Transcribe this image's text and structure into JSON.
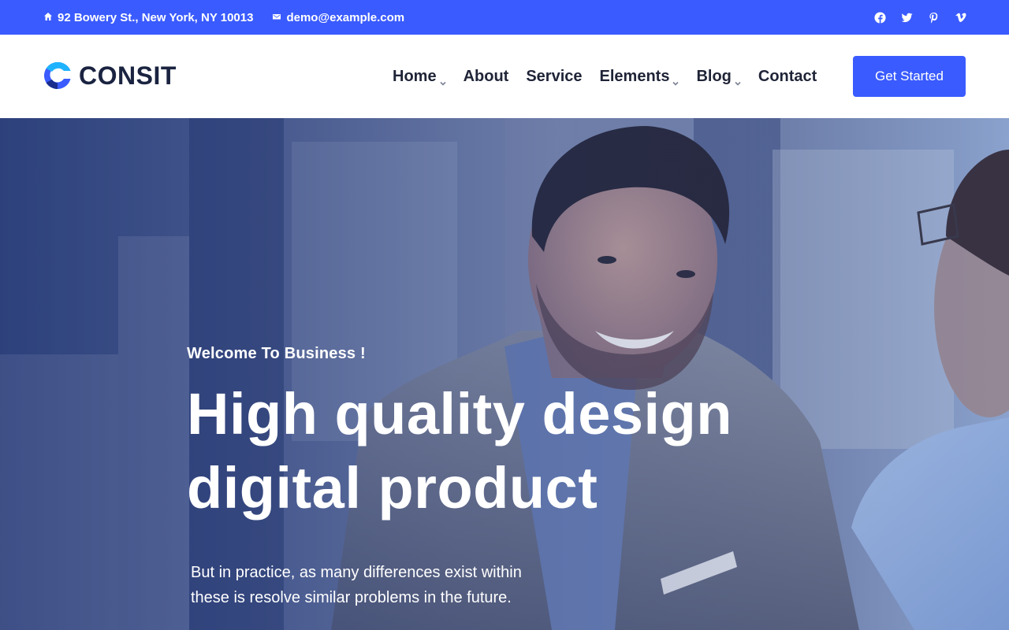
{
  "topbar": {
    "address": "92 Bowery St., New York, NY 10013",
    "email": "demo@example.com",
    "address_icon": "home-icon",
    "email_icon": "mail-icon",
    "social": [
      "facebook-icon",
      "twitter-icon",
      "pinterest-icon",
      "vimeo-icon"
    ],
    "background": "#3a5bff"
  },
  "header": {
    "logo_text": "CONSIT",
    "nav": [
      {
        "label": "Home",
        "dropdown": true
      },
      {
        "label": "About",
        "dropdown": false
      },
      {
        "label": "Service",
        "dropdown": false
      },
      {
        "label": "Elements",
        "dropdown": true
      },
      {
        "label": "Blog",
        "dropdown": true
      },
      {
        "label": "Contact",
        "dropdown": false
      }
    ],
    "cta_label": "Get Started",
    "accent": "#3a5bff"
  },
  "hero": {
    "eyebrow": "Welcome To Business !",
    "headline_line1": "High quality design",
    "headline_line2": "digital product",
    "subtext": "But in practice, as many differences exist within these is resolve similar problems in the future."
  }
}
